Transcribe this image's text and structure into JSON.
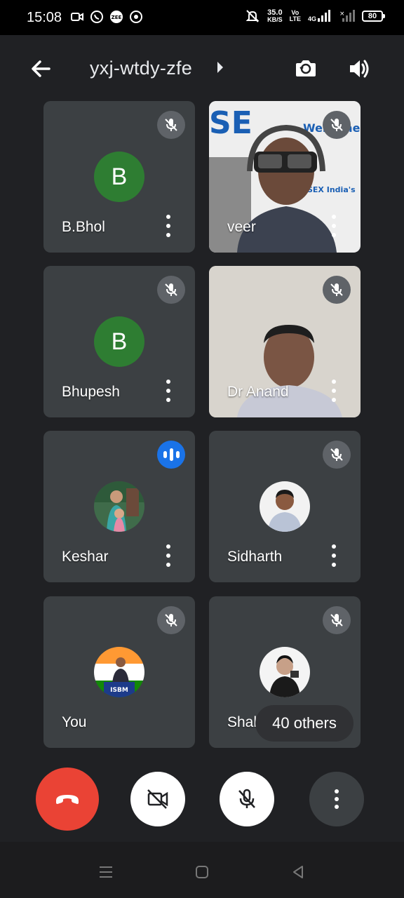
{
  "status_bar": {
    "time": "15:08",
    "net_speed": "35.0",
    "net_speed_unit": "KB/S",
    "volte_top": "Vo",
    "volte_bottom": "LTE",
    "network_type": "4G",
    "battery": "80"
  },
  "header": {
    "meeting_code": "yxj-wtdy-zfe"
  },
  "participants": [
    {
      "name": "B.Bhol",
      "initial": "B",
      "state": "muted"
    },
    {
      "name": "veer",
      "state": "muted"
    },
    {
      "name": "Bhupesh",
      "initial": "B",
      "state": "muted"
    },
    {
      "name": "Dr Anand",
      "state": "muted"
    },
    {
      "name": "Keshar",
      "state": "speaking"
    },
    {
      "name": "Sidharth",
      "state": "muted"
    },
    {
      "name": "You",
      "state": "muted"
    },
    {
      "name": "Shah",
      "state": "muted"
    }
  ],
  "others_label": "40 others",
  "colors": {
    "background": "#202124",
    "tile": "#3c4043",
    "avatar_green": "#2e7d32",
    "speaking_blue": "#1a73e8",
    "end_call_red": "#ea4335"
  },
  "icons": {
    "back": "arrow-left-icon",
    "camera_switch": "camera-switch-icon",
    "speaker": "volume-icon",
    "muted": "mic-off-icon",
    "end_call": "phone-hangup-icon",
    "camera_off": "video-off-icon",
    "mic_off": "mic-off-icon",
    "more": "more-vertical-icon"
  }
}
